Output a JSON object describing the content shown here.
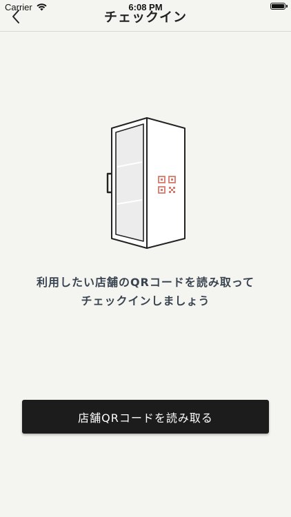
{
  "status_bar": {
    "carrier": "Carrier",
    "time": "6:08 PM"
  },
  "nav": {
    "title": "チェックイン"
  },
  "illustration": {
    "icon": "fridge-with-qr-icon",
    "qr_color": "#d9776a"
  },
  "instruction": {
    "line1": "利用したい店舗のQRコードを読み取って",
    "line2": "チェックインしましょう"
  },
  "button": {
    "label": "店舗QRコードを読み取る"
  }
}
